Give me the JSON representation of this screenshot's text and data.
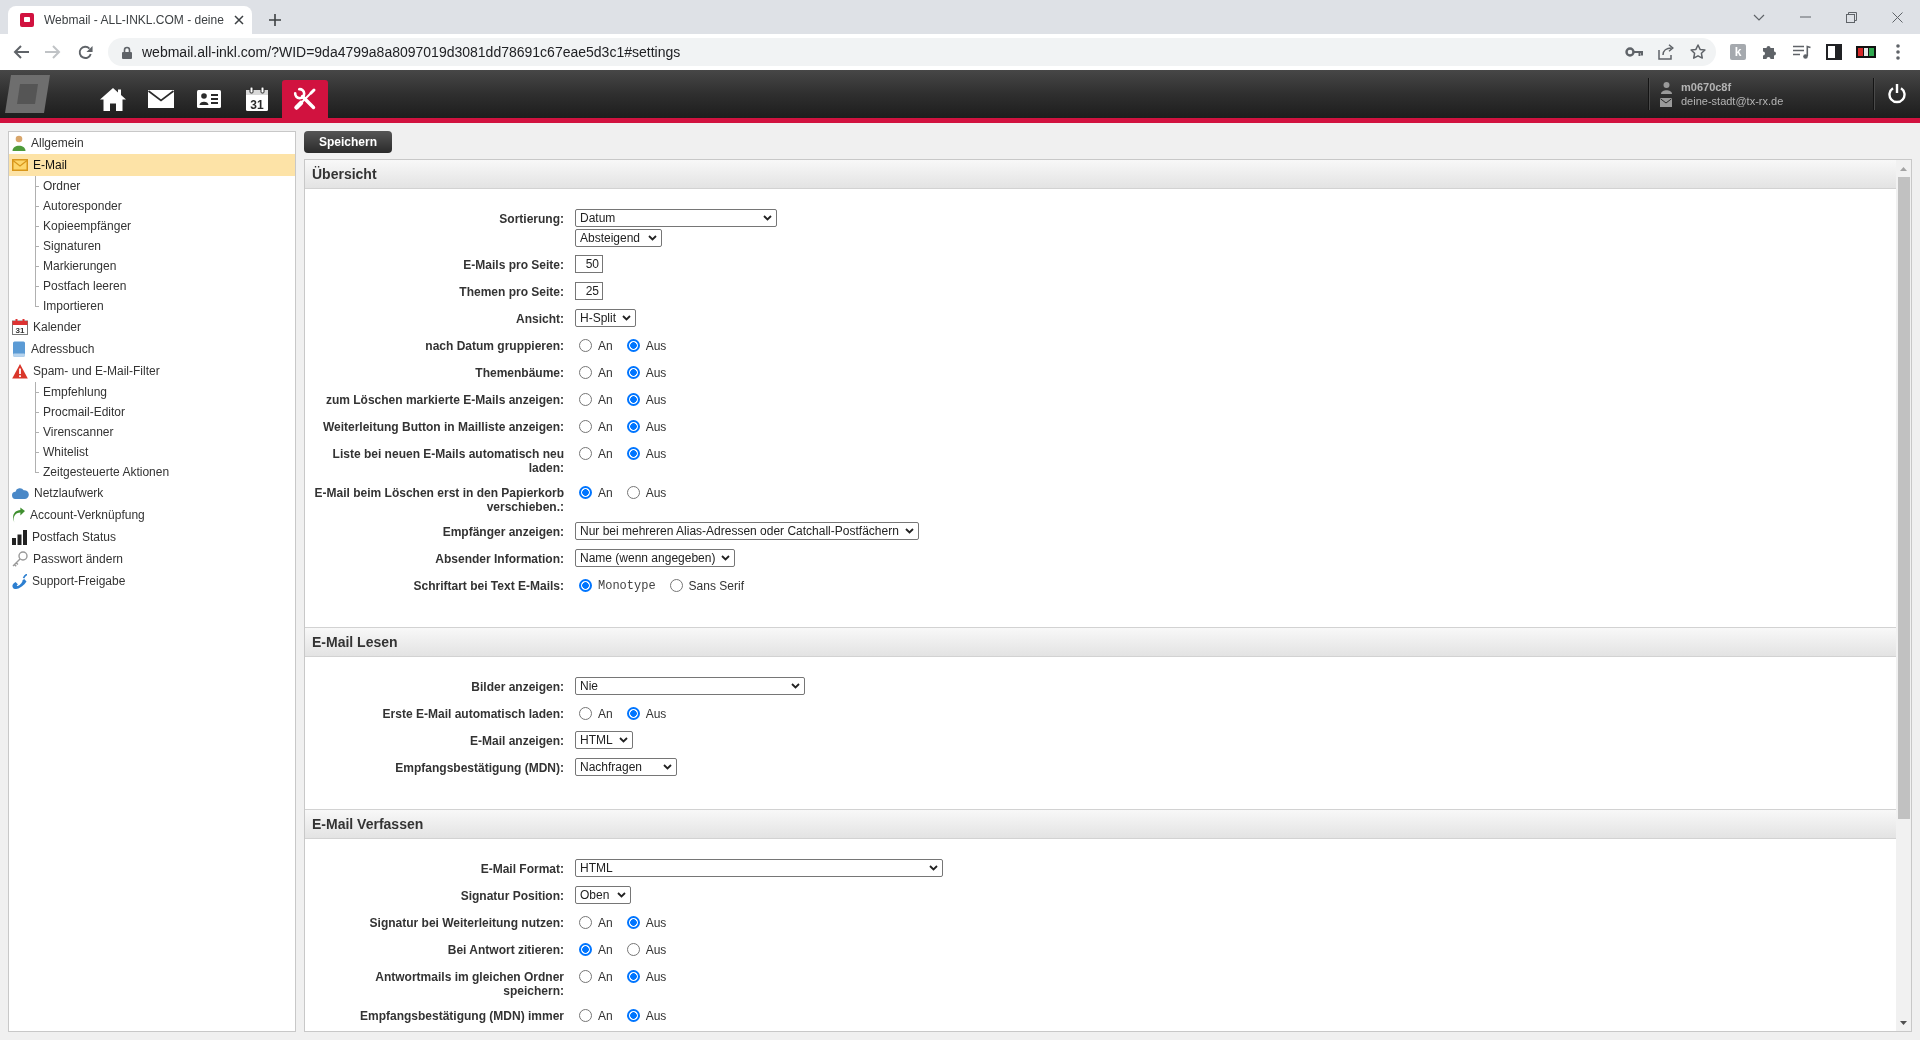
{
  "browser": {
    "tab": {
      "title": "Webmail - ALL-INKL.COM - deine",
      "selected": true
    },
    "url": "webmail.all-inkl.com/?WID=9da4799a8a8097019d3081dd78691c67eae5d3c1#settings",
    "extension_letter": "k"
  },
  "header": {
    "nav": [
      {
        "kind": "home",
        "selected": false
      },
      {
        "kind": "mail",
        "selected": false
      },
      {
        "kind": "contacts",
        "selected": false
      },
      {
        "kind": "calendar",
        "icon_text": "31",
        "selected": false
      },
      {
        "kind": "tools",
        "selected": true
      }
    ],
    "user": {
      "name": "m0670c8f",
      "email": "deine-stadt@tx-rx.de"
    }
  },
  "toolbar": {
    "save_button": "Speichern"
  },
  "sidebar": {
    "items": [
      {
        "kind": "user",
        "label": "Allgemein",
        "selected": false
      },
      {
        "kind": "mail",
        "label": "E-Mail",
        "selected": true,
        "children": [
          {
            "label": "Ordner",
            "selected": false
          },
          {
            "label": "Autoresponder",
            "selected": false
          },
          {
            "label": "Kopieempfänger",
            "selected": false
          },
          {
            "label": "Signaturen",
            "selected": false
          },
          {
            "label": "Markierungen",
            "selected": false
          },
          {
            "label": "Postfach leeren",
            "selected": false
          },
          {
            "label": "Importieren",
            "selected": false
          }
        ]
      },
      {
        "kind": "calendar",
        "label": "Kalender",
        "icon_text": "31",
        "selected": false
      },
      {
        "kind": "book",
        "label": "Adressbuch",
        "selected": false
      },
      {
        "kind": "warning",
        "label": "Spam- und E-Mail-Filter",
        "selected": false,
        "children": [
          {
            "label": "Empfehlung",
            "selected": false
          },
          {
            "label": "Procmail-Editor",
            "selected": false
          },
          {
            "label": "Virenscanner",
            "selected": false
          },
          {
            "label": "Whitelist",
            "selected": false
          },
          {
            "label": "Zeitgesteuerte Aktionen",
            "selected": false
          }
        ]
      },
      {
        "kind": "cloud",
        "label": "Netzlaufwerk",
        "selected": false
      },
      {
        "kind": "arrow",
        "label": "Account-Verknüpfung",
        "selected": false
      },
      {
        "kind": "chart",
        "label": "Postfach Status",
        "selected": false
      },
      {
        "kind": "key",
        "label": "Passwort ändern",
        "selected": false
      },
      {
        "kind": "phone",
        "label": "Support-Freigabe",
        "selected": false
      }
    ]
  },
  "sections": [
    {
      "title": "Übersicht",
      "rows": [
        {
          "kind": "select",
          "label": "Sortierung:",
          "values": [
            "Datum",
            "Absteigend"
          ]
        },
        {
          "kind": "number",
          "label": "E-Mails pro Seite:",
          "value": "50"
        },
        {
          "kind": "number",
          "label": "Themen pro Seite:",
          "value": "25"
        },
        {
          "kind": "select",
          "label": "Ansicht:",
          "values": [
            "H-Split"
          ]
        },
        {
          "kind": "radio",
          "label": "nach Datum gruppieren:",
          "options": [
            {
              "label": "An",
              "selected": false
            },
            {
              "label": "Aus",
              "selected": true
            }
          ]
        },
        {
          "kind": "radio",
          "label": "Themenbäume:",
          "options": [
            {
              "label": "An",
              "selected": false
            },
            {
              "label": "Aus",
              "selected": true
            }
          ]
        },
        {
          "kind": "radio",
          "label": "zum Löschen markierte E-Mails anzeigen:",
          "options": [
            {
              "label": "An",
              "selected": false
            },
            {
              "label": "Aus",
              "selected": true
            }
          ]
        },
        {
          "kind": "radio",
          "label": "Weiterleitung Button in Mailliste anzeigen:",
          "options": [
            {
              "label": "An",
              "selected": false
            },
            {
              "label": "Aus",
              "selected": true
            }
          ]
        },
        {
          "kind": "radio",
          "label": "Liste bei neuen E-Mails automatisch neu laden:",
          "options": [
            {
              "label": "An",
              "selected": false
            },
            {
              "label": "Aus",
              "selected": true
            }
          ]
        },
        {
          "kind": "radio",
          "label": "E-Mail beim Löschen erst in den Papierkorb verschieben.:",
          "options": [
            {
              "label": "An",
              "selected": true
            },
            {
              "label": "Aus",
              "selected": false
            }
          ]
        },
        {
          "kind": "select",
          "label": "Empfänger anzeigen:",
          "values": [
            "Nur bei mehreren Alias-Adressen oder Catchall-Postfächern"
          ]
        },
        {
          "kind": "select",
          "label": "Absender Information:",
          "values": [
            "Name (wenn angegeben)"
          ]
        },
        {
          "kind": "font_radio",
          "label": "Schriftart bei Text E-Mails:",
          "options": [
            {
              "label": "Monotype",
              "selected": true
            },
            {
              "label": "Sans Serif",
              "selected": false
            }
          ]
        }
      ]
    },
    {
      "title": "E-Mail Lesen",
      "rows": [
        {
          "kind": "select",
          "label": "Bilder anzeigen:",
          "values": [
            "Nie"
          ]
        },
        {
          "kind": "radio",
          "label": "Erste E-Mail automatisch laden:",
          "options": [
            {
              "label": "An",
              "selected": false
            },
            {
              "label": "Aus",
              "selected": true
            }
          ]
        },
        {
          "kind": "select",
          "label": "E-Mail anzeigen:",
          "values": [
            "HTML"
          ]
        },
        {
          "kind": "select",
          "label": "Empfangsbestätigung (MDN):",
          "values": [
            "Nachfragen"
          ]
        }
      ]
    },
    {
      "title": "E-Mail Verfassen",
      "rows": [
        {
          "kind": "select",
          "label": "E-Mail Format:",
          "values": [
            "HTML"
          ]
        },
        {
          "kind": "select",
          "label": "Signatur Position:",
          "values": [
            "Oben"
          ]
        },
        {
          "kind": "radio",
          "label": "Signatur bei Weiterleitung nutzen:",
          "options": [
            {
              "label": "An",
              "selected": false
            },
            {
              "label": "Aus",
              "selected": true
            }
          ]
        },
        {
          "kind": "radio",
          "label": "Bei Antwort zitieren:",
          "options": [
            {
              "label": "An",
              "selected": true
            },
            {
              "label": "Aus",
              "selected": false
            }
          ]
        },
        {
          "kind": "radio",
          "label": "Antwortmails im gleichen Ordner speichern:",
          "options": [
            {
              "label": "An",
              "selected": false
            },
            {
              "label": "Aus",
              "selected": true
            }
          ]
        },
        {
          "kind": "radio",
          "label": "Empfangsbestätigung (MDN) immer",
          "options": [
            {
              "label": "An",
              "selected": false
            },
            {
              "label": "Aus",
              "selected": true
            }
          ]
        }
      ]
    }
  ]
}
